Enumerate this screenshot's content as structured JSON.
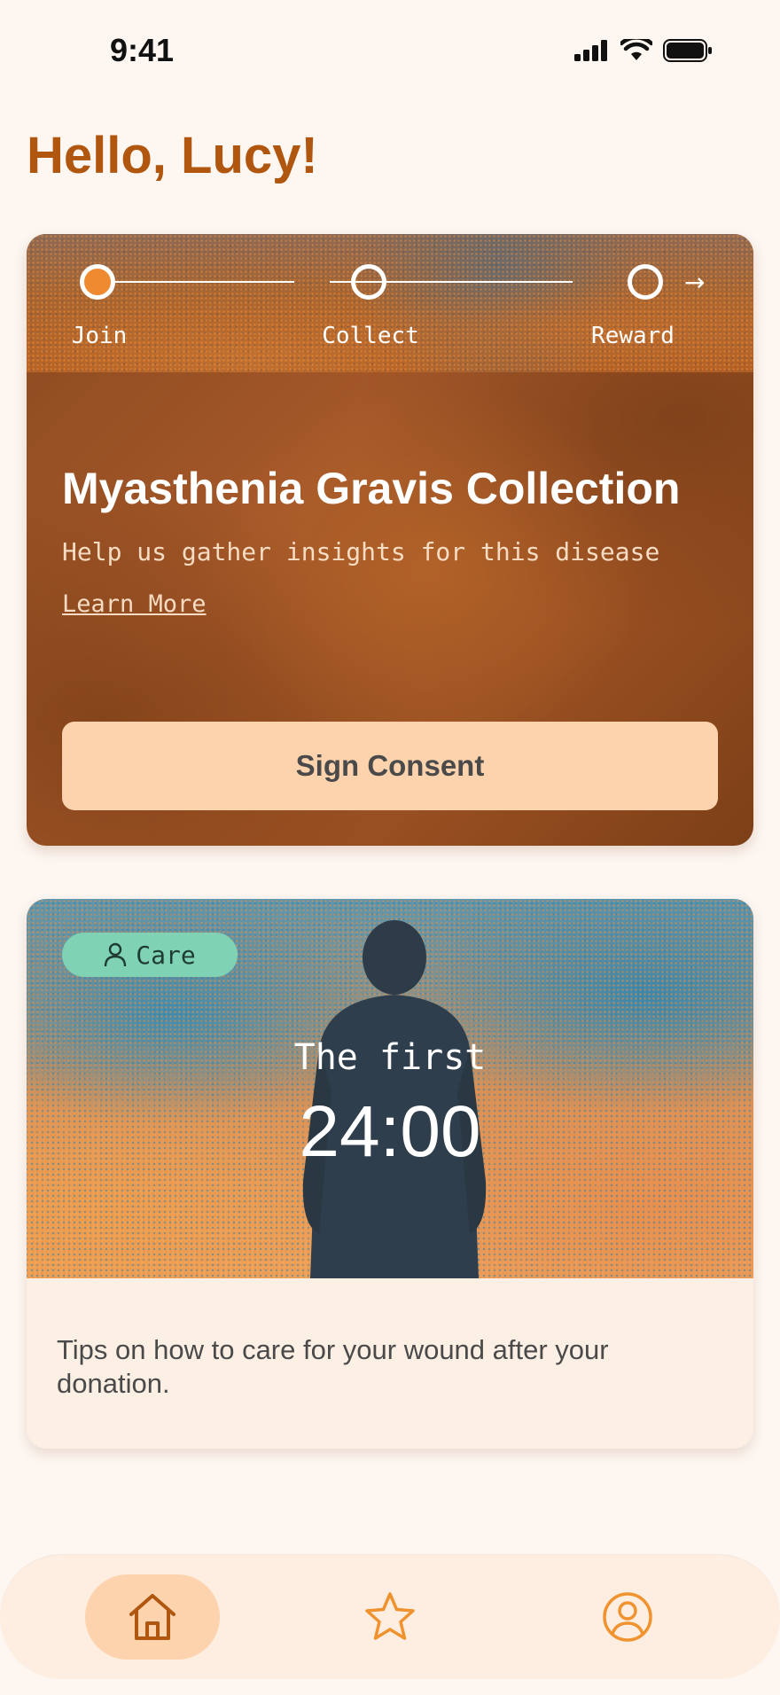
{
  "status_bar": {
    "time": "9:41"
  },
  "greeting": "Hello, Lucy!",
  "collection_card": {
    "steps": [
      {
        "label": "Join",
        "active": true
      },
      {
        "label": "Collect",
        "active": false
      },
      {
        "label": "Reward",
        "active": false
      }
    ],
    "title": "Myasthenia Gravis Collection",
    "subtitle": "Help us gather insights for this disease",
    "learn_more": "Learn More",
    "button_label": "Sign Consent"
  },
  "care_card": {
    "badge": "Care",
    "overline": "The first",
    "time": "24:00",
    "description": "Tips on how to care for your wound after your donation."
  },
  "tab_bar": {
    "tabs": [
      {
        "icon": "home-icon",
        "active": true
      },
      {
        "icon": "star-icon",
        "active": false
      },
      {
        "icon": "profile-icon",
        "active": false
      }
    ]
  },
  "colors": {
    "background": "#fdf6f1",
    "accent": "#b0560f",
    "button": "#fdd3ad",
    "badge": "#7fd3b4",
    "icon": "#f0922e"
  }
}
